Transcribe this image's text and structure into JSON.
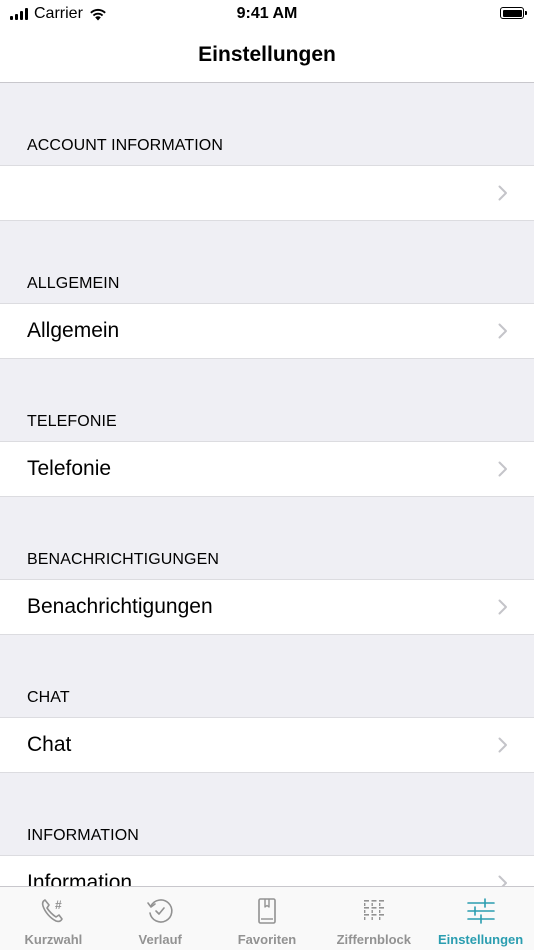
{
  "status_bar": {
    "carrier": "Carrier",
    "time": "9:41 AM"
  },
  "nav": {
    "title": "Einstellungen"
  },
  "sections": [
    {
      "header": "ACCOUNT INFORMATION",
      "row_label": ""
    },
    {
      "header": "ALLGEMEIN",
      "row_label": "Allgemein"
    },
    {
      "header": "TELEFONIE",
      "row_label": "Telefonie"
    },
    {
      "header": "BENACHRICHTIGUNGEN",
      "row_label": "Benachrichtigungen"
    },
    {
      "header": "CHAT",
      "row_label": "Chat"
    },
    {
      "header": "INFORMATION",
      "row_label": "Information"
    }
  ],
  "tab_bar": {
    "tabs": [
      {
        "label": "Kurzwahl",
        "icon": "speed-dial-icon",
        "active": false
      },
      {
        "label": "Verlauf",
        "icon": "history-icon",
        "active": false
      },
      {
        "label": "Favoriten",
        "icon": "favorites-book-icon",
        "active": false
      },
      {
        "label": "Ziffernblock",
        "icon": "keypad-icon",
        "active": false
      },
      {
        "label": "Einstellungen",
        "icon": "settings-sliders-icon",
        "active": true
      }
    ]
  },
  "colors": {
    "accent": "#2a9db0",
    "inactive_tab": "#929292",
    "background": "#efeff4"
  }
}
